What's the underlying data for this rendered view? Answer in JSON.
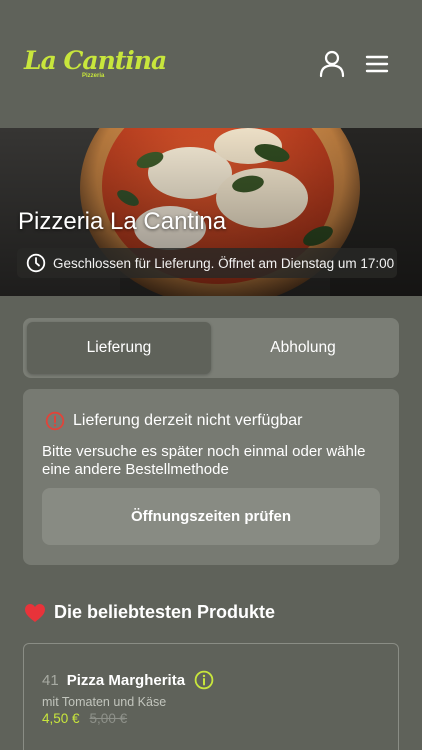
{
  "header": {
    "logo_text": "La Cantina",
    "logo_subtext": "Pizzeria",
    "user_icon": "user-icon",
    "menu_icon": "menu-icon"
  },
  "hero": {
    "title": "Pizzeria La Cantina",
    "status_icon": "clock-icon",
    "status_text": "Geschlossen für Lieferung. Öffnet am Dienstag um 17:00"
  },
  "order_mode": {
    "tabs": [
      {
        "label": "Lieferung",
        "active": true
      },
      {
        "label": "Abholung",
        "active": false
      }
    ]
  },
  "notice": {
    "icon": "warning-icon",
    "title": "Lieferung derzeit nicht verfügbar",
    "body": "Bitte versuche es später noch einmal oder wähle eine andere Bestellmethode",
    "button_label": "Öffnungszeiten prüfen"
  },
  "popular": {
    "icon": "heart-icon",
    "title": "Die beliebtesten Produkte",
    "products": [
      {
        "number": "41",
        "name": "Pizza Margherita",
        "description": "mit Tomaten und Käse",
        "price": "4,50 €",
        "old_price": "5,00 €"
      }
    ]
  },
  "colors": {
    "background": "#5f625a",
    "accent": "#c8e63c",
    "warning": "#e0443a",
    "heart": "#e8333a"
  }
}
